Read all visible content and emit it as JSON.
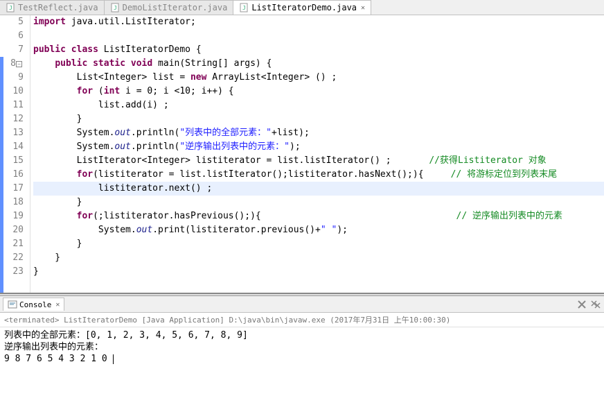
{
  "tabs": [
    {
      "label": "TestReflect.java",
      "active": false
    },
    {
      "label": "DemoListIterator.java",
      "active": false
    },
    {
      "label": "ListIteratorDemo.java",
      "active": true
    }
  ],
  "line_numbers": [
    5,
    6,
    7,
    8,
    9,
    10,
    11,
    12,
    13,
    14,
    15,
    16,
    17,
    18,
    19,
    20,
    21,
    22,
    23
  ],
  "code": {
    "l5_import": "import",
    "l5_rest": " java.util.ListIterator;",
    "l7_public": "public",
    "l7_class": " class",
    "l7_rest": " ListIteratorDemo {",
    "l8_public": "public",
    "l8_static": " static",
    "l8_void": " void",
    "l8_rest": " main(String[] args) {",
    "l9_rest": "        List<Integer> list = ",
    "l9_new": "new",
    "l9_rest2": " ArrayList<Integer> () ;",
    "l10_for": "for",
    "l10_paren": " (",
    "l10_int": "int",
    "l10_rest": " i = 0; i <10; i++) {",
    "l11": "            list.add(i) ;",
    "l12": "        }",
    "l13a": "        System.",
    "l13_out": "out",
    "l13b": ".println(",
    "l13_str": "\"列表中的全部元素：\"",
    "l13c": "+list);",
    "l14a": "        System.",
    "l14_out": "out",
    "l14b": ".println(",
    "l14_str": "\"逆序输出列表中的元素：\"",
    "l14c": ");",
    "l15": "        ListIterator<Integer> listiterator = list.listIterator() ;",
    "l15_cmt": "       //获得Listiterator 对象",
    "l16_for": "for",
    "l16a": "(listiterator = list.listIterator();listiterator.hasNext();){",
    "l16_cmt": "     // 将游标定位到列表末尾",
    "l17": "            listiterator.next() ;",
    "l18": "        }",
    "l19_for": "for",
    "l19a": "(;listiterator.hasPrevious();){",
    "l19_cmt": "                                    // 逆序输出列表中的元素",
    "l20a": "            System.",
    "l20_out": "out",
    "l20b": ".print(listiterator.previous()+",
    "l20_str": "\" \"",
    "l20c": ");",
    "l21": "        }",
    "l22": "    }",
    "l23": "}"
  },
  "console": {
    "tab_label": "Console",
    "status": "<terminated> ListIteratorDemo [Java Application] D:\\java\\bin\\javaw.exe (2017年7月31日 上午10:00:30)",
    "output_lines": [
      "列表中的全部元素：[0, 1, 2, 3, 4, 5, 6, 7, 8, 9]",
      "逆序输出列表中的元素：",
      "9 8 7 6 5 4 3 2 1 0 "
    ]
  }
}
